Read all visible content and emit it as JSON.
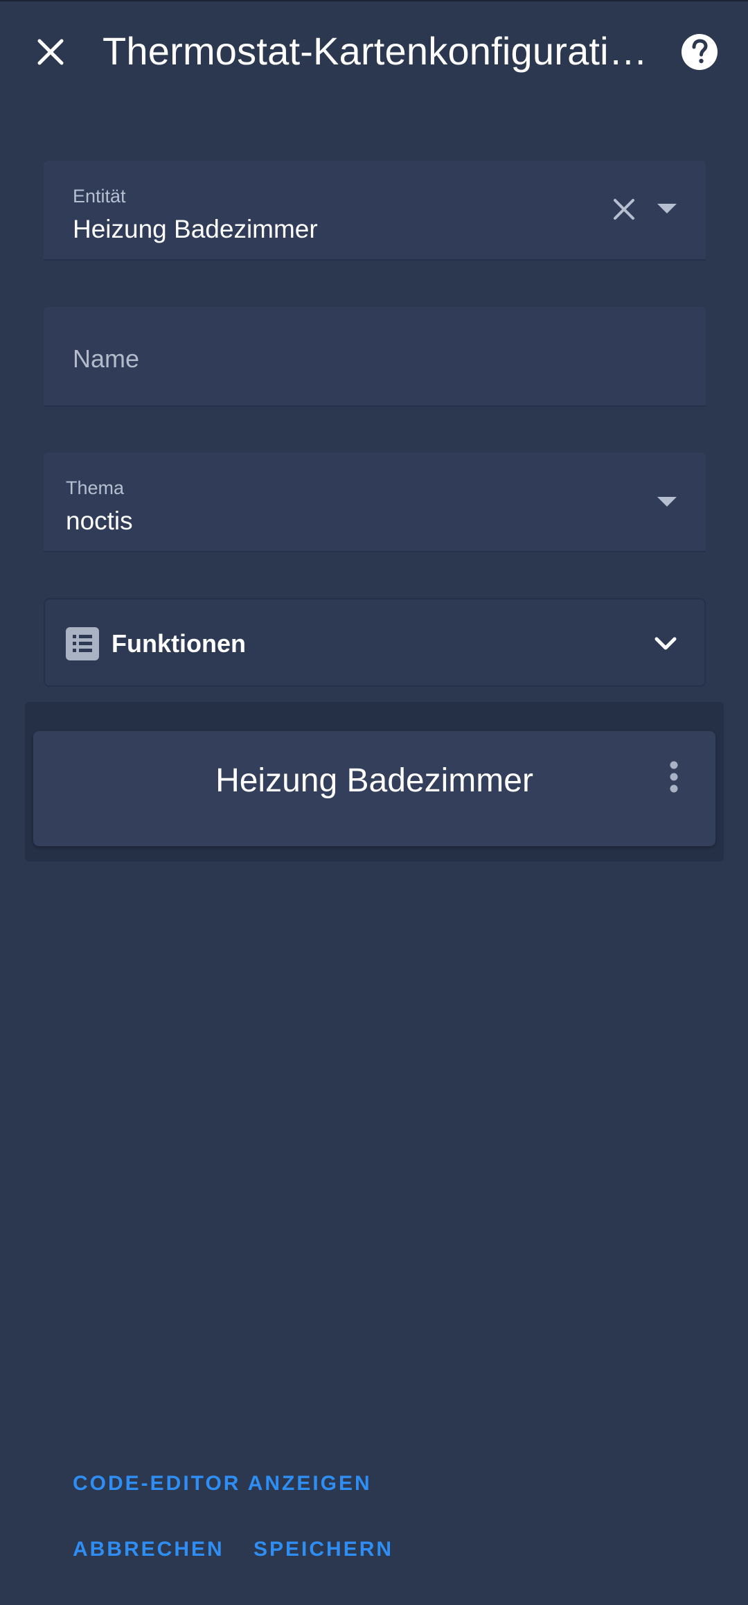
{
  "header": {
    "title": "Thermostat-Kartenkonfiguration"
  },
  "fields": {
    "entity": {
      "label": "Entität",
      "value": "Heizung Badezimmer"
    },
    "name": {
      "placeholder": "Name"
    },
    "theme": {
      "label": "Thema",
      "value": "noctis"
    }
  },
  "features": {
    "label": "Funktionen"
  },
  "preview": {
    "card_title": "Heizung Badezimmer"
  },
  "footer": {
    "code_editor": "CODE-EDITOR ANZEIGEN",
    "cancel": "ABBRECHEN",
    "save": "SPEICHERN"
  },
  "colors": {
    "background": "#2c3750",
    "field": "#313d58",
    "accent": "#2f8ef3"
  }
}
